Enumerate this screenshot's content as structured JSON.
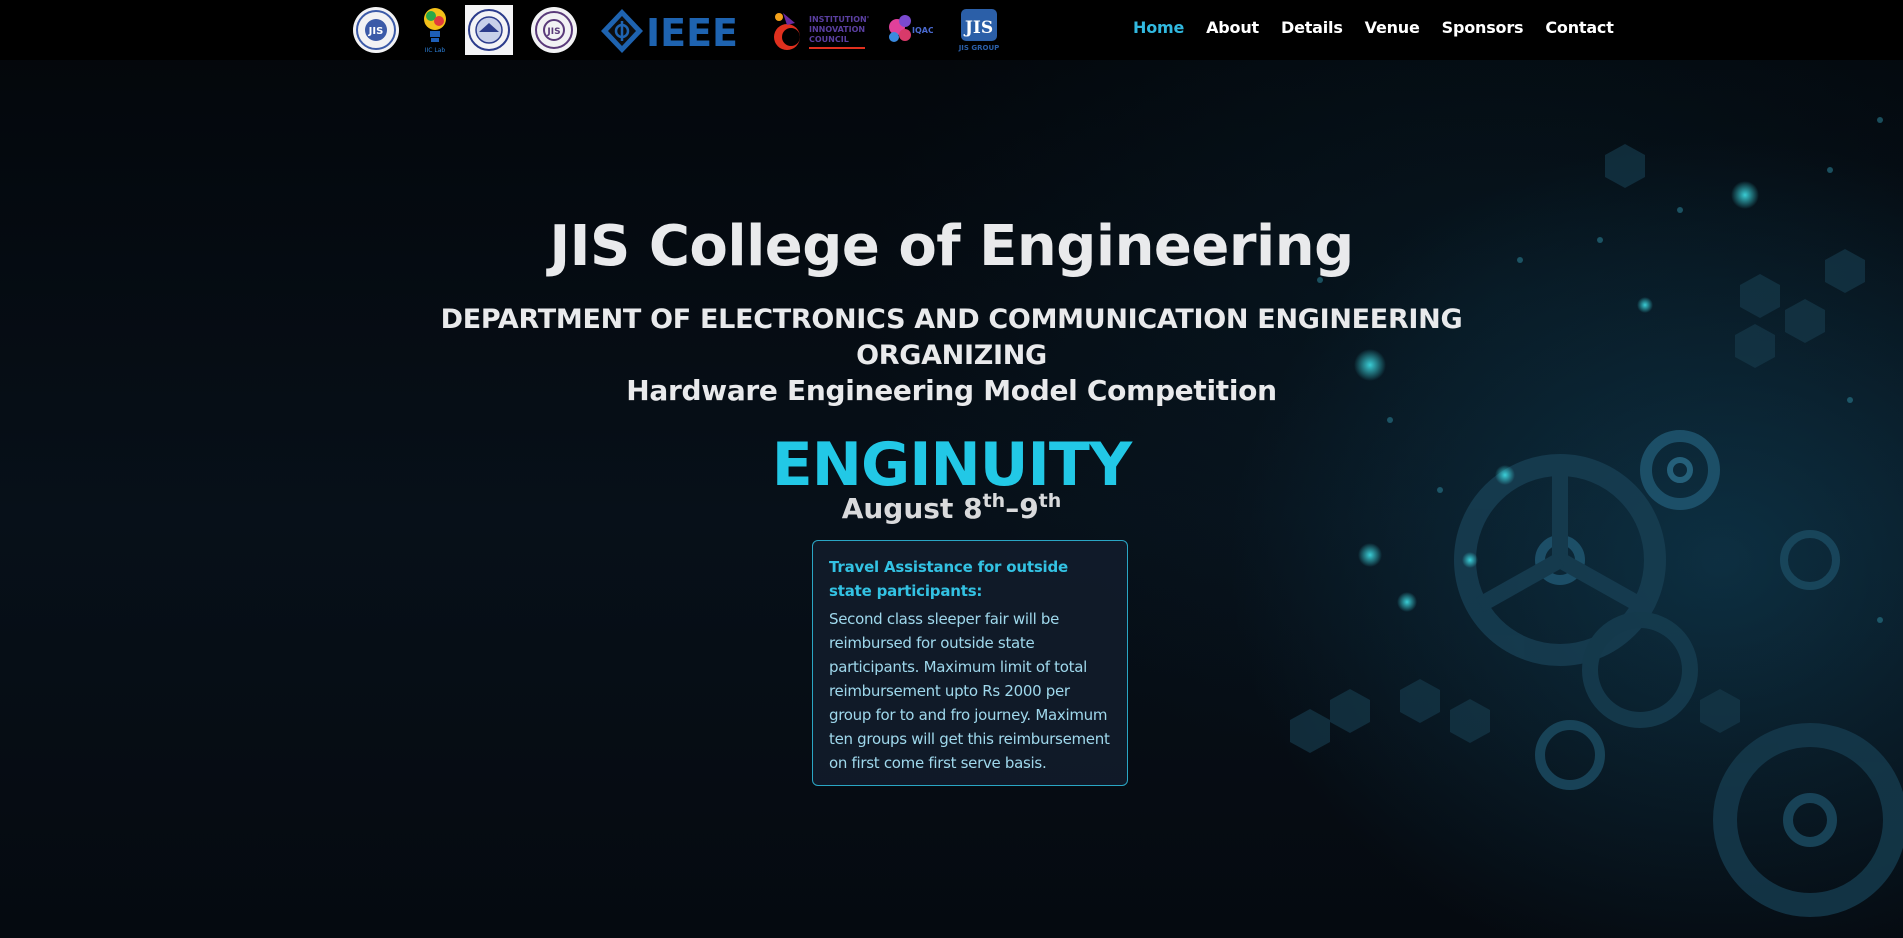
{
  "header": {
    "logos": [
      {
        "icon": "jis-college-seal-icon"
      },
      {
        "icon": "iic-bulb-icon",
        "caption": "IIC Lab"
      },
      {
        "icon": "university-seal-icon"
      },
      {
        "icon": "jis-round-seal-icon"
      },
      {
        "icon": "ieee-logo-icon",
        "text": "IEEE"
      },
      {
        "icon": "institution-innovation-council-icon",
        "lines": [
          "INSTITUTION'S",
          "INNOVATION",
          "COUNCIL"
        ]
      },
      {
        "icon": "iqac-logo-icon",
        "text": "IQAC"
      },
      {
        "icon": "jis-group-logo-icon",
        "text": "JIS",
        "caption": "JIS GROUP"
      }
    ],
    "nav": [
      {
        "label": "Home",
        "active": true
      },
      {
        "label": "About",
        "active": false
      },
      {
        "label": "Details",
        "active": false
      },
      {
        "label": "Venue",
        "active": false
      },
      {
        "label": "Sponsors",
        "active": false
      },
      {
        "label": "Contact",
        "active": false
      }
    ]
  },
  "hero": {
    "college": "JIS College of Engineering",
    "department_line1": "DEPARTMENT OF ELECTRONICS AND COMMUNICATION ENGINEERING",
    "department_line2": "ORGANIZING",
    "competition": "Hardware Engineering Model Competition",
    "event_name": "ENGINUITY",
    "date": {
      "prefix": "August 8",
      "sup1": "th",
      "sep": "–9",
      "sup2": "th"
    }
  },
  "notice": {
    "title": "Travel Assistance for outside state participants:",
    "body": "Second class sleeper fair will be reimbursed for outside state participants. Maximum limit of total reimbursement upto Rs 2000 per group for to and fro journey. Maximum ten groups will get this reimbursement on first come first serve basis."
  },
  "colors": {
    "accent": "#22c8e6",
    "nav_active": "#31b9e0",
    "background": "#04070b",
    "notice_border": "#2aa6c4"
  }
}
